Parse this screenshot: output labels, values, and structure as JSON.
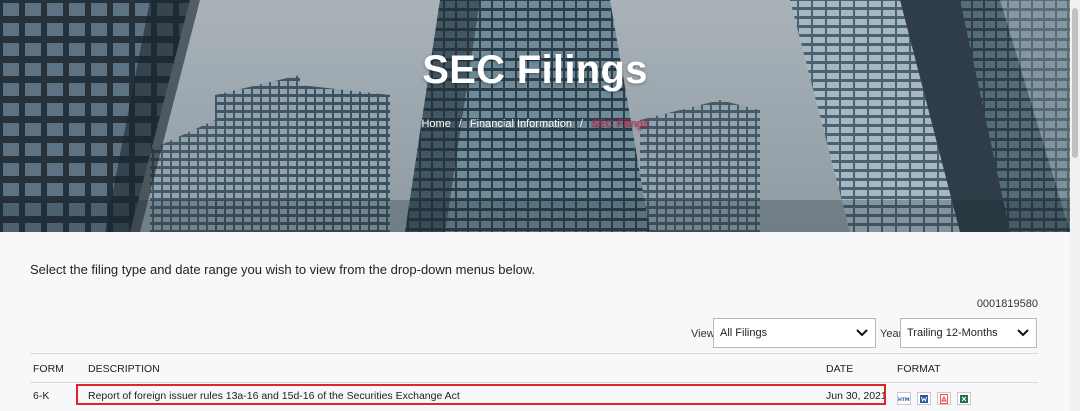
{
  "hero": {
    "title": "SEC Filings",
    "breadcrumb": [
      "Home",
      "Financial Information",
      "SEC Filings"
    ],
    "separator": "/"
  },
  "intro_text": "Select the filing type and date range you wish to view from the drop-down menus below.",
  "cik": "0001819580",
  "filters": {
    "view_label": "View",
    "view_value": "All Filings",
    "year_label": "Year",
    "year_value": "Trailing 12-Months"
  },
  "table": {
    "headers": {
      "form": "FORM",
      "description": "DESCRIPTION",
      "date": "DATE",
      "format": "FORMAT"
    },
    "rows": [
      {
        "form": "6-K",
        "description": "Report of foreign issuer rules 13a-16 and 15d-16 of the Securities Exchange Act",
        "date": "Jun 30, 2021",
        "formats": [
          "html-icon",
          "word-icon",
          "pdf-icon",
          "excel-icon"
        ]
      }
    ]
  },
  "colors": {
    "breadcrumb_current": "#d8204a",
    "highlight_border": "#e0242c",
    "html_icon": "#2a57a8",
    "word_icon": "#2b579a",
    "pdf_icon": "#d9292b",
    "excel_icon": "#1e7145"
  }
}
